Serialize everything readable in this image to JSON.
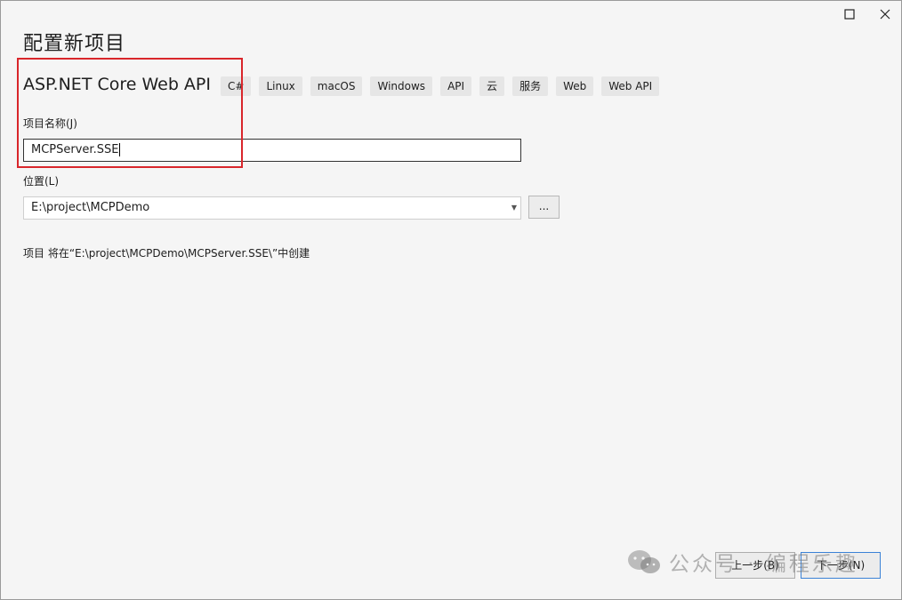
{
  "window": {
    "controls": {
      "maximize_icon": "maximize-icon",
      "close_icon": "close-icon"
    }
  },
  "page_title": "配置新项目",
  "template": {
    "name": "ASP.NET Core Web API",
    "tags": [
      "C#",
      "Linux",
      "macOS",
      "Windows",
      "API",
      "云",
      "服务",
      "Web",
      "Web API"
    ]
  },
  "project_name": {
    "label": "项目名称(J)",
    "value": "MCPServer.SSE"
  },
  "location": {
    "label": "位置(L)",
    "value": "E:\\project\\MCPDemo",
    "browse_label": "..."
  },
  "create_message": "项目 将在“E:\\project\\MCPDemo\\MCPServer.SSE\\”中创建",
  "footer": {
    "back_label": "上一步(B)",
    "next_label": "下一步(N)"
  },
  "watermark": "公众号 · 编程乐趣",
  "colors": {
    "highlight": "#d9262b",
    "focus": "#3b82d6"
  }
}
